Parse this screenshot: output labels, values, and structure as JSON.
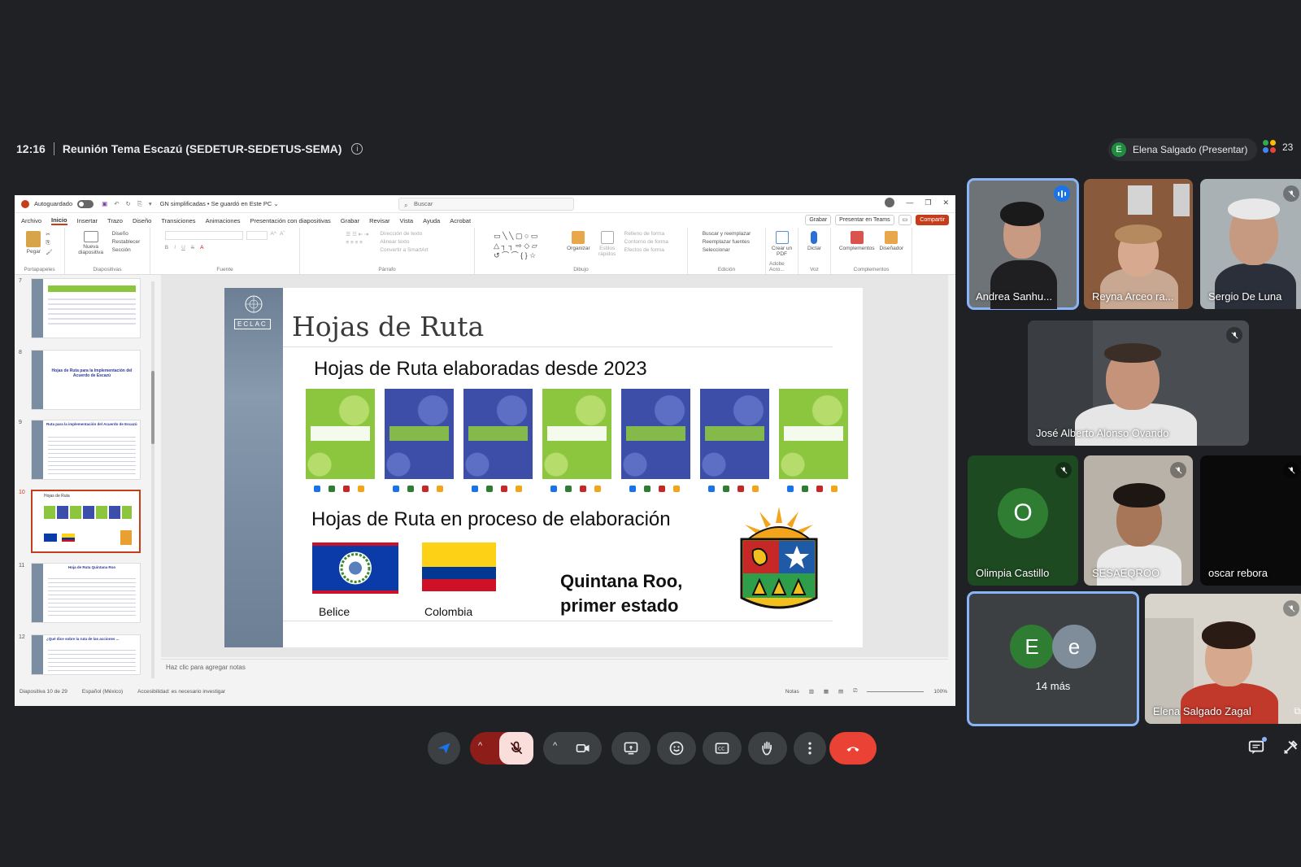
{
  "meeting": {
    "time": "12:16",
    "title": "Reunión Tema Escazú (SEDETUR-SEDETUS-SEMA)",
    "presenter_initial": "E",
    "presenter_label": "Elena Salgado (Presentar)",
    "participant_count": "23"
  },
  "ppt": {
    "autosave": "Autoguardado",
    "filename": "GN simplificadas  •  Se guardó en Este PC  ⌄",
    "search_placeholder": "Buscar",
    "tabs": [
      "Archivo",
      "Inicio",
      "Insertar",
      "Trazo",
      "Diseño",
      "Transiciones",
      "Animaciones",
      "Presentación con diapositivas",
      "Grabar",
      "Revisar",
      "Vista",
      "Ayuda",
      "Acrobat"
    ],
    "tab_buttons": {
      "record": "Grabar",
      "teams": "Presentar en Teams",
      "share": "Compartir"
    },
    "ribbon": {
      "paste": "Pegar",
      "clipboard": "Portapapeles",
      "new_slide": "Nueva diapositiva",
      "layout": "Diseño",
      "reset": "Restablecer",
      "section": "Sección",
      "slides": "Diapositivas",
      "font": "Fuente",
      "paragraph": "Párrafo",
      "text_direction": "Dirección de texto",
      "align_text": "Alinear texto",
      "smartart": "Convertir a SmartArt",
      "arrange": "Organizar",
      "quick_styles": "Estilos rápidos",
      "fill": "Relleno de forma",
      "outline": "Contorno de forma",
      "effects": "Efectos de forma",
      "drawing": "Dibujo",
      "find": "Buscar y reemplazar",
      "replace_fonts": "Reemplazar fuentes",
      "select": "Seleccionar",
      "editing": "Edición",
      "create_pdf": "Crear un PDF",
      "adobe": "Adobe Acro...",
      "dictate": "Dictar",
      "voice": "Voz",
      "addins": "Complementos",
      "addins_group": "Complementos",
      "designer": "Diseñador"
    },
    "thumbs": [
      {
        "num": "7",
        "title": ""
      },
      {
        "num": "8",
        "title": "Hojas de Ruta para la Implementación del Acuerdo de Escazú"
      },
      {
        "num": "9",
        "title": "Ruta para la implementación del Acuerdo de Escazú"
      },
      {
        "num": "10",
        "title": "Hojas de Ruta"
      },
      {
        "num": "11",
        "title": "Hoja de Ruta Quintana Roo"
      },
      {
        "num": "12",
        "title": "¿Qué dice sobre la ruta de las acciones ..."
      }
    ],
    "notes_placeholder": "Haz clic para agregar notas",
    "status": {
      "slide": "Diapositiva 10 de 29",
      "language": "Español (México)",
      "accessibility": "Accesibilidad: es necesario investigar",
      "notes": "Notas",
      "zoom": "100%"
    }
  },
  "slide": {
    "logo_text": "ECLAC",
    "title": "Hojas de Ruta",
    "heading1": "Hojas de Ruta elaboradas desde 2023",
    "heading2": "Hojas de Ruta en proceso de elaboración",
    "flags": [
      "Belice",
      "Colombia"
    ],
    "state_text_line1": "Quintana Roo,",
    "state_text_line2": "primer estado"
  },
  "tiles": [
    {
      "name": "Andrea Sanhu..."
    },
    {
      "name": "Reyna Arceo ra..."
    },
    {
      "name": "Sergio De Luna"
    },
    {
      "name": "José Alberto Alonso Ovando"
    },
    {
      "name": "Olimpia Castillo",
      "initial": "O"
    },
    {
      "name": "SESAEQROO"
    },
    {
      "name": "oscar rebora"
    },
    {
      "more_label": "14 más",
      "initials": [
        "E",
        "e"
      ]
    },
    {
      "name": "Elena Salgado Zagal"
    }
  ],
  "colors": {
    "background": "#202124",
    "hangup": "#ea4335",
    "mic_off": "#f9dedc",
    "mic_off_group": "#8c1d18",
    "ppt_accent": "#c43e1c",
    "green_cover": "#8cc63f",
    "blue_cover": "#3d4ea8"
  },
  "icons": [
    "info-icon",
    "people-icon",
    "search-icon",
    "mic-off-icon",
    "camera-icon",
    "present-icon",
    "emoji-icon",
    "captions-icon",
    "raise-hand-icon",
    "more-icon",
    "hangup-icon",
    "chat-icon",
    "tools-icon"
  ]
}
